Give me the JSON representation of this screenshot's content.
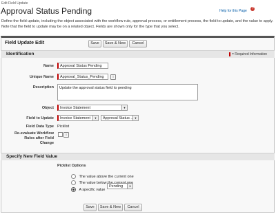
{
  "header": {
    "subtitle": "Edit Field Update",
    "title": "Approval Status Pending",
    "help_link": "Help for this Page",
    "help_icon": "help-icon"
  },
  "description": "Define the field update, including the object associated with the workflow rule, approval process, or entitlement process, the field to update, and the value to apply. Note that the field to update may be on a related object. Fields are shown only for the type that you select.",
  "block": {
    "title": "Field Update Edit",
    "save_label": "Save",
    "save_new_label": "Save & New",
    "cancel_label": "Cancel"
  },
  "identification": {
    "section_title": "Identification",
    "required_info": "= Required Information",
    "name_label": "Name",
    "name_value": "Approval Status Pending",
    "unique_name_label": "Unique Name",
    "unique_name_value": "Approval_Status_Pending",
    "description_label": "Description",
    "description_value": "Update the approval status field to pending",
    "object_label": "Object",
    "object_value": "Invoice Statement",
    "field_label": "Field to Update",
    "field_object_value": "Invoice Statement",
    "field_value": "Approval Status ...",
    "field_type_label": "Field Data Type",
    "field_type_value": "Picklist",
    "reevaluate_label_1": "Re-evaluate Workflow",
    "reevaluate_label_2": "Rules after Field",
    "reevaluate_label_3": "Change",
    "info_glyph": "i"
  },
  "new_value": {
    "section_title": "Specify New Field Value",
    "picklist_label": "Picklist Options",
    "option_above": "The value above the current one",
    "option_below": "The value below the current one",
    "option_specific": "A specific value",
    "specific_value": "Pending"
  },
  "colors": {
    "accent_red": "#c00000",
    "section_gray": "#e6e6e6",
    "link_blue": "#015ba7"
  }
}
